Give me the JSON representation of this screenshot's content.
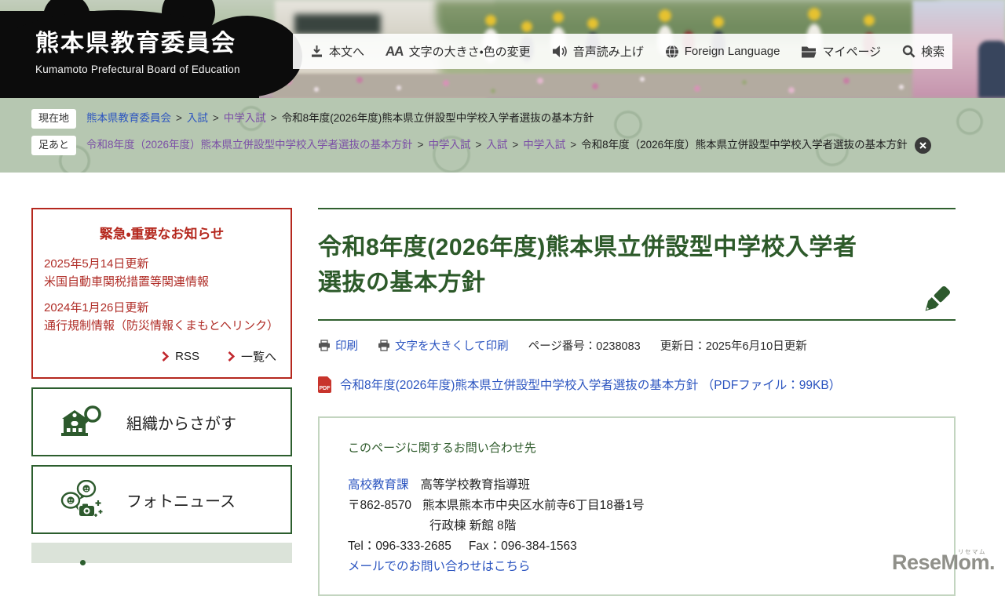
{
  "site": {
    "name": "熊本県教育委員会",
    "name_en": "Kumamoto Prefectural Board of Education"
  },
  "utility_nav": {
    "items": [
      {
        "label": "本文へ",
        "icon": "download-icon"
      },
      {
        "label": "文字の大きさ・色の変更",
        "icon": "text-size-icon"
      },
      {
        "label": "音声読み上げ",
        "icon": "speaker-icon"
      },
      {
        "label": "Foreign Language",
        "icon": "globe-icon"
      },
      {
        "label": "マイページ",
        "icon": "folder-icon"
      },
      {
        "label": "検索",
        "icon": "search-icon"
      }
    ]
  },
  "breadcrumbs": {
    "separator": ">",
    "current_label": "現在地",
    "current_trail": [
      {
        "text": "熊本県教育委員会",
        "type": "link"
      },
      {
        "text": "入試",
        "type": "link"
      },
      {
        "text": "中学入試",
        "type": "visited"
      },
      {
        "text": "令和8年度(2026年度)熊本県立併設型中学校入学者選抜の基本方針",
        "type": "current"
      }
    ],
    "footprints_label": "足あと",
    "footprints_trail": [
      {
        "text": "令和8年度（2026年度）熊本県立併設型中学校入学者選抜の基本方針",
        "type": "visited"
      },
      {
        "text": "中学入試",
        "type": "visited"
      },
      {
        "text": "入試",
        "type": "visited"
      },
      {
        "text": "中学入試",
        "type": "visited"
      },
      {
        "text": "令和8年度（2026年度）熊本県立併設型中学校入学者選抜の基本方針",
        "type": "current"
      }
    ]
  },
  "sidebar": {
    "emergency": {
      "title": "緊急・重要なお知らせ",
      "items": [
        {
          "date": "2025年5月14日更新",
          "text": "米国自動車関税措置等関連情報"
        },
        {
          "date": "2024年1月26日更新",
          "text": "通行規制情報（防災情報くまもとへリンク）"
        }
      ],
      "rss_label": "RSS",
      "list_label": "一覧へ"
    },
    "nav_boxes": [
      {
        "label": "組織からさがす",
        "icon": "organization-search-icon"
      },
      {
        "label": "フォトニュース",
        "icon": "photo-news-icon"
      }
    ]
  },
  "main": {
    "title": "令和8年度(2026年度)熊本県立併設型中学校入学者選抜の基本方針",
    "meta": {
      "print_label": "印刷",
      "print_large_label": "文字を大きくして印刷",
      "page_number": "ページ番号：0238083",
      "updated": "更新日：2025年6月10日更新"
    },
    "pdf_badge": "PDF",
    "pdf_link": "令和8年度(2026年度)熊本県立併設型中学校入学者選抜の基本方針 （PDFファイル：99KB）",
    "contact": {
      "heading": "このページに関するお問い合わせ先",
      "department_link": "高校教育課",
      "department_sub": "高等学校教育指導班",
      "postal": "〒862-8570",
      "address": "熊本県熊本市中央区水前寺6丁目18番1号",
      "address2": "行政棟 新館 8階",
      "tel": "Tel：096-333-2685",
      "fax": "Fax：096-384-1563",
      "mail_link": "メールでのお問い合わせはこちら"
    }
  },
  "watermark": {
    "text": "ReseMom.",
    "ruby": "リセマム"
  },
  "colors": {
    "brand_green": "#2d5a2a",
    "band_sage": "#b6c7b1",
    "alert_red": "#b5281e",
    "link_blue": "#2c55c0",
    "visited_purple": "#7b4fa6",
    "pdf_red": "#c8342c"
  }
}
